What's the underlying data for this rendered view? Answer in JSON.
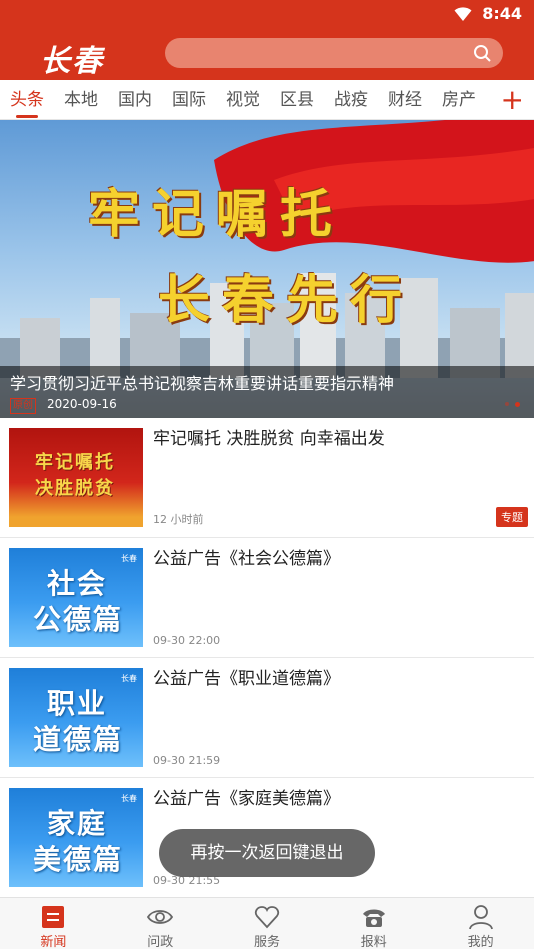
{
  "status_bar": {
    "time": "8:44"
  },
  "header": {
    "logo": "长春",
    "search_placeholder": ""
  },
  "tabs": [
    {
      "label": "头条",
      "active": true
    },
    {
      "label": "本地"
    },
    {
      "label": "国内"
    },
    {
      "label": "国际"
    },
    {
      "label": "视觉"
    },
    {
      "label": "区县"
    },
    {
      "label": "战疫"
    },
    {
      "label": "财经"
    },
    {
      "label": "房产"
    }
  ],
  "tab_add_label": "+",
  "banner": {
    "headline_line1": "牢记嘱托",
    "headline_line2": "长春先行",
    "title": "学习贯彻习近平总书记视察吉林重要讲话重要指示精神",
    "badge": "原创",
    "date": "2020-09-16"
  },
  "news": [
    {
      "title": "牢记嘱托 决胜脱贫 向幸福出发",
      "time": "12 小时前",
      "badge": "专题",
      "thumb_line1": "牢记嘱托",
      "thumb_line2": "决胜脱贫"
    },
    {
      "title": "公益广告《社会公德篇》",
      "time": "09-30 22:00",
      "thumb_line1": "社会",
      "thumb_line2": "公德篇",
      "thumb_corner": "长春"
    },
    {
      "title": "公益广告《职业道德篇》",
      "time": "09-30 21:59",
      "thumb_line1": "职业",
      "thumb_line2": "道德篇",
      "thumb_corner": "长春"
    },
    {
      "title": "公益广告《家庭美德篇》",
      "time": "09-30 21:55",
      "thumb_line1": "家庭",
      "thumb_line2": "美德篇",
      "thumb_corner": "长春"
    }
  ],
  "toast": "再按一次返回键退出",
  "bottom_nav": [
    {
      "label": "新闻",
      "icon": "news-icon",
      "active": true
    },
    {
      "label": "问政",
      "icon": "eye-icon"
    },
    {
      "label": "服务",
      "icon": "heart-icon"
    },
    {
      "label": "报料",
      "icon": "phone-icon"
    },
    {
      "label": "我的",
      "icon": "user-icon"
    }
  ],
  "colors": {
    "brand": "#d5341c"
  }
}
